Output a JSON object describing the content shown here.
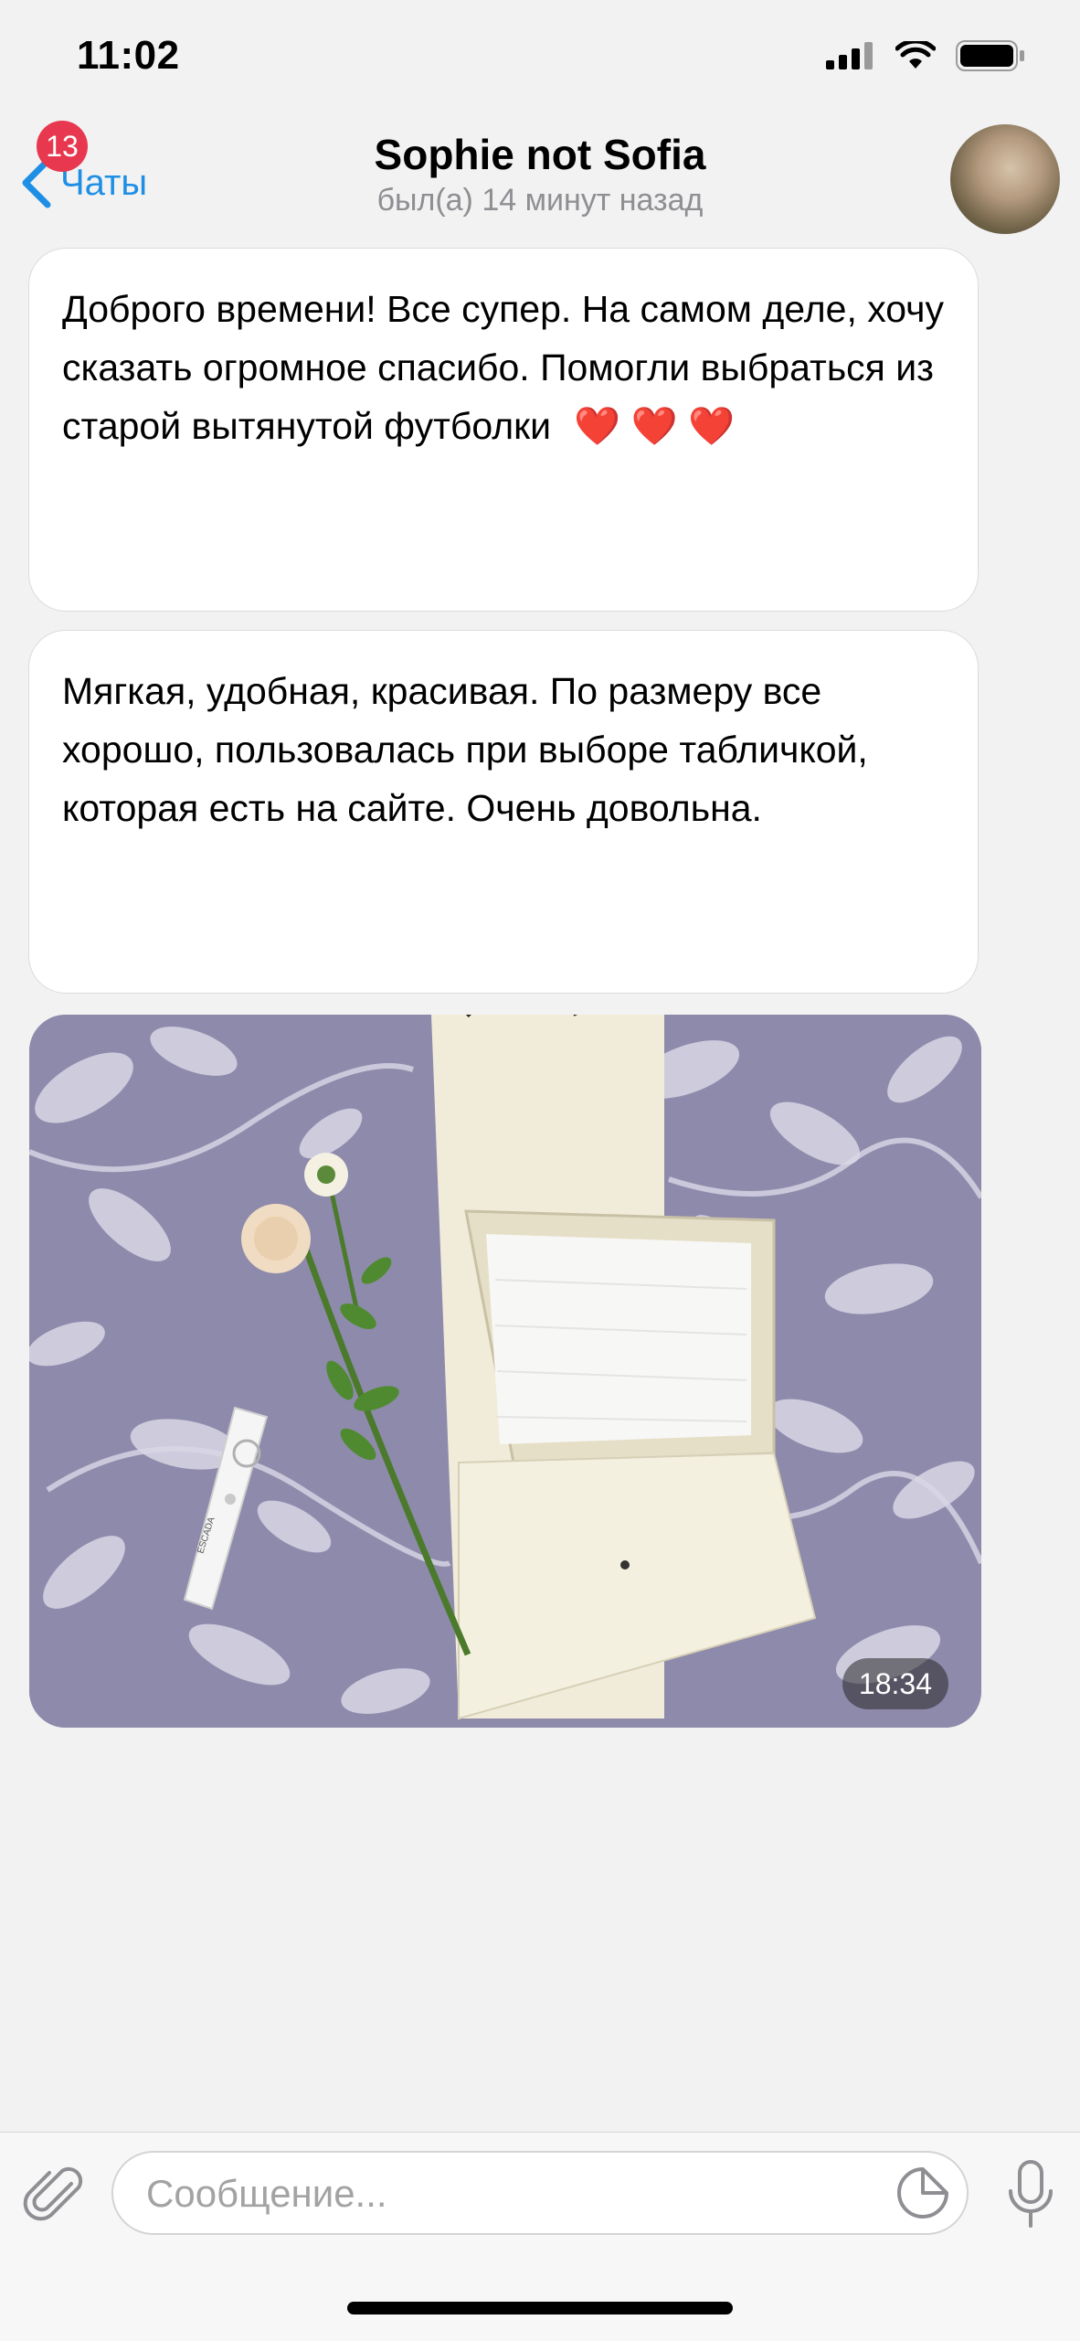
{
  "status_bar": {
    "time": "11:02"
  },
  "nav": {
    "back_label": "Чаты",
    "unread_count": "13",
    "contact_name": "Sophie not Sofia",
    "last_seen": "был(а) 14 минут назад"
  },
  "messages": [
    {
      "text": "Доброго времени! Все супер. На самом деле, хочу сказать огромное спасибо. Помогли выбраться из старой вытянутой футболки",
      "emoji": "❤️ ❤️ ❤️"
    },
    {
      "text": "Мягкая, удобная, красивая. По размеру все хорошо, пользовалась при выборе табличкой, которая есть на сайте. Очень довольна."
    }
  ],
  "photo": {
    "time": "18:34",
    "remote_text": "ESCADA"
  },
  "composer": {
    "placeholder": "Сообщение..."
  },
  "colors": {
    "accent": "#1f8fe5",
    "badge": "#e8384f"
  }
}
